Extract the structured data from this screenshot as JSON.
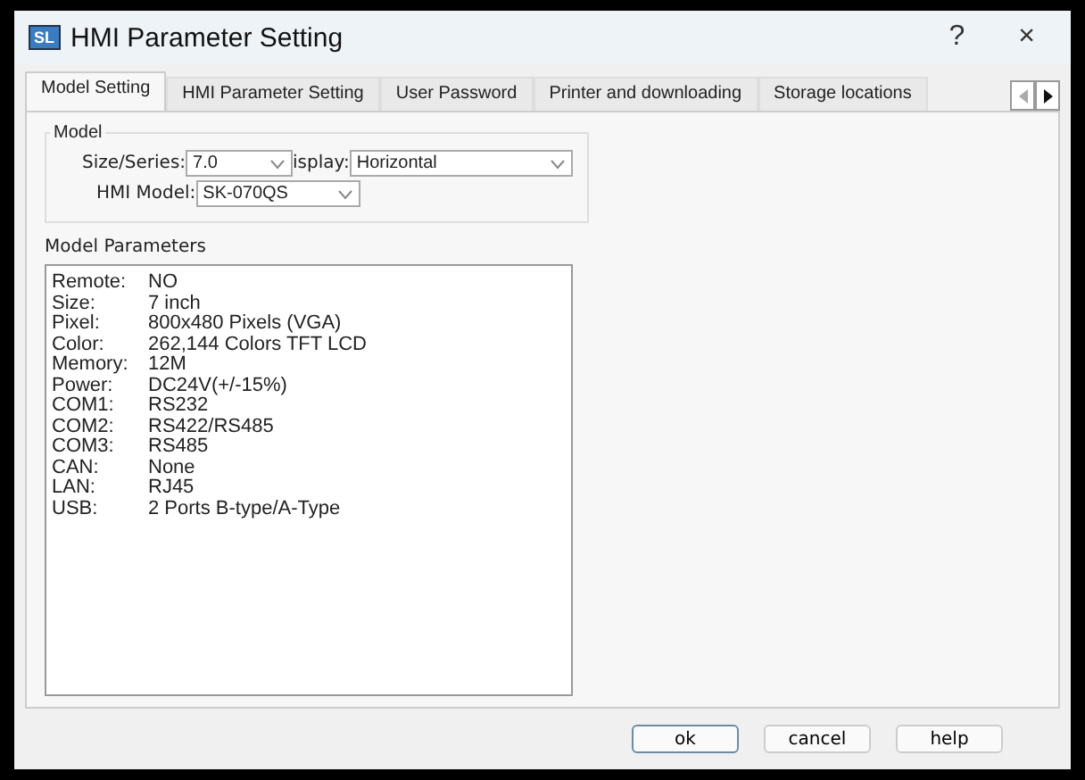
{
  "window": {
    "title": "HMI Parameter Setting",
    "app_icon": "SL",
    "help": "?",
    "close": "×"
  },
  "tabs": [
    {
      "label": "Model Setting",
      "selected": true
    },
    {
      "label": "HMI Parameter Setting",
      "selected": false
    },
    {
      "label": "User Password",
      "selected": false
    },
    {
      "label": "Printer and downloading",
      "selected": false
    },
    {
      "label": "Storage locations",
      "selected": false
    }
  ],
  "model": {
    "title": "Model",
    "size_label": "Size/Series:",
    "size_value": "7.0",
    "display_label": "isplay:",
    "display_value": "Horizontal",
    "hmi_label": "HMI Model:",
    "hmi_value": "SK-070QS"
  },
  "parameters": {
    "title": "Model Parameters",
    "lines": [
      {
        "label": "Remote:",
        "value": "NO"
      },
      {
        "label": "Size:",
        "value": "7 inch"
      },
      {
        "label": "Pixel:",
        "value": "800x480 Pixels (VGA)"
      },
      {
        "label": "Color:",
        "value": "262,144 Colors TFT LCD"
      },
      {
        "label": "Memory:",
        "value": "12M"
      },
      {
        "label": "Power:",
        "value": "DC24V(+/-15%)"
      },
      {
        "label": "COM1:",
        "value": "RS232"
      },
      {
        "label": "COM2:",
        "value": "RS422/RS485"
      },
      {
        "label": "COM3:",
        "value": "RS485"
      },
      {
        "label": "CAN:",
        "value": "None"
      },
      {
        "label": "LAN:",
        "value": "RJ45"
      },
      {
        "label": "USB:",
        "value": "2 Ports B-type/A-Type"
      }
    ]
  },
  "buttons": [
    {
      "label": "ok",
      "selected": true
    },
    {
      "label": "cancel",
      "selected": false
    },
    {
      "label": "help",
      "selected": false
    }
  ]
}
